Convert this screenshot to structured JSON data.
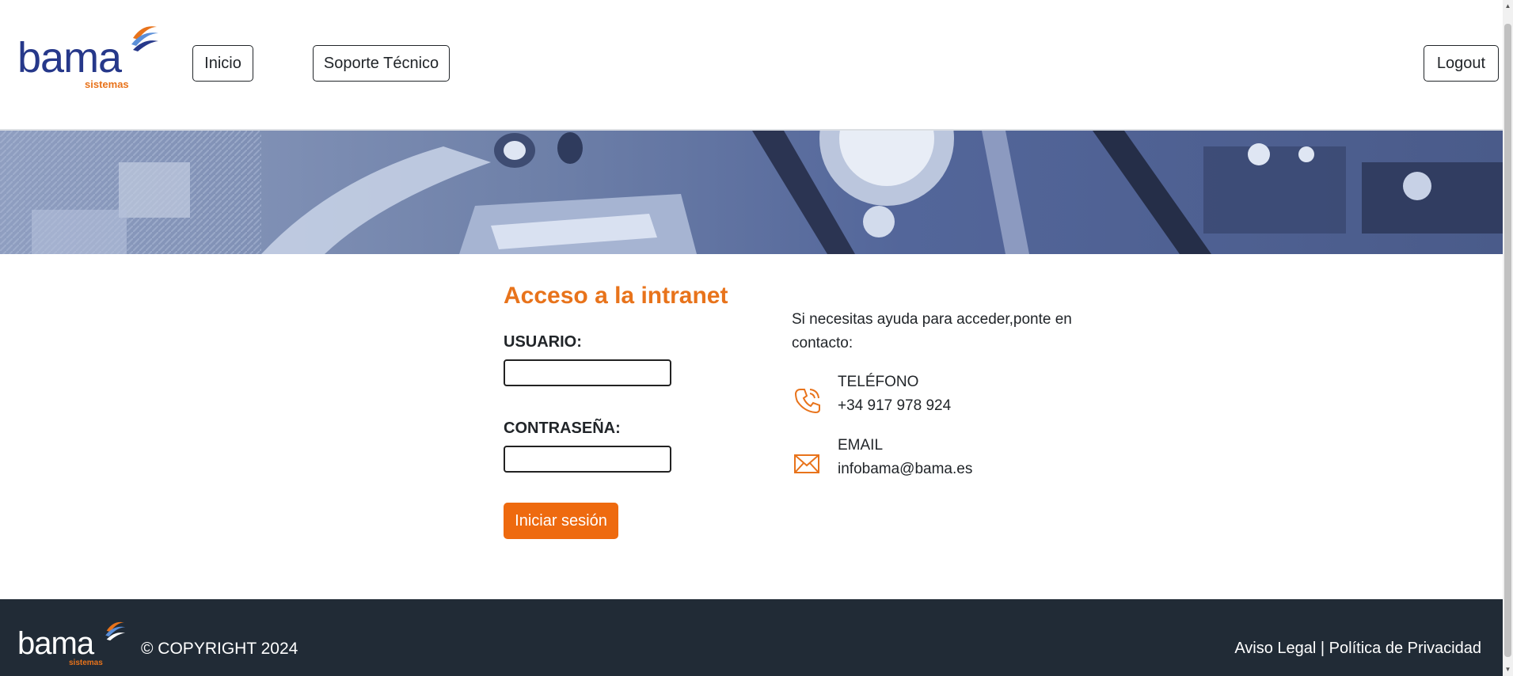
{
  "header": {
    "logo": {
      "word": "bama",
      "sub": "sistemas"
    },
    "nav": {
      "inicio": "Inicio",
      "soporte": "Soporte Técnico"
    },
    "logout": "Logout"
  },
  "login": {
    "title": "Acceso a la intranet",
    "user_label": "USUARIO:",
    "user_value": "",
    "password_label": "CONTRASEÑA:",
    "password_value": "",
    "submit": "Iniciar sesión"
  },
  "help": {
    "text": "Si necesitas ayuda para acceder,ponte en contacto:",
    "phone_label": "TELÉFONO",
    "phone_value": "+34 917 978 924",
    "email_label": "EMAIL",
    "email_value": "infobama@bama.es"
  },
  "footer": {
    "logo": {
      "word": "bama",
      "sub": "sistemas"
    },
    "copyright": "© COPYRIGHT 2024",
    "aviso": "Aviso Legal",
    "separator": " | ",
    "privacidad": "Política de Privacidad"
  },
  "colors": {
    "accent": "#ee6a0f",
    "title": "#e8731b",
    "brand_blue": "#26388a",
    "footer_bg": "#212b36"
  },
  "icons": {
    "phone": "phone-icon",
    "email": "mail-icon",
    "logo_swoosh": "swoosh-icon"
  }
}
